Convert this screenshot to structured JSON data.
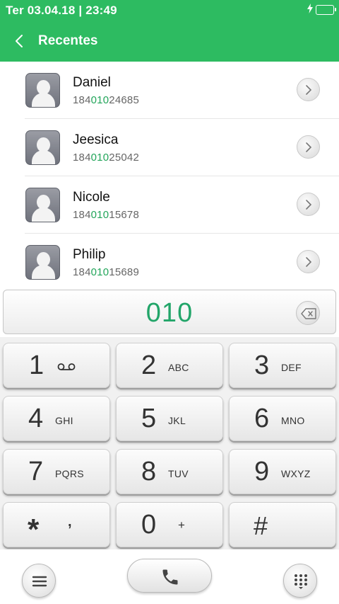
{
  "status_bar": {
    "datetime": "Ter 03.04.18 | 23:49",
    "icons": [
      "charging-icon",
      "battery-icon"
    ]
  },
  "header": {
    "back_icon": "chevron-left-icon",
    "title": "Recentes"
  },
  "contacts": [
    {
      "name": "Daniel",
      "number_prefix": "184",
      "number_match": "010",
      "number_suffix": "24685"
    },
    {
      "name": "Jeesica",
      "number_prefix": "184",
      "number_match": "010",
      "number_suffix": "25042"
    },
    {
      "name": "Nicole",
      "number_prefix": "184",
      "number_match": "010",
      "number_suffix": "15678"
    },
    {
      "name": "Philip",
      "number_prefix": "184",
      "number_match": "010",
      "number_suffix": "15689"
    }
  ],
  "dialer": {
    "input": "010",
    "backspace_icon": "backspace-icon"
  },
  "keypad": [
    {
      "digit": "1",
      "letters": ""
    },
    {
      "digit": "2",
      "letters": "ABC"
    },
    {
      "digit": "3",
      "letters": "DEF"
    },
    {
      "digit": "4",
      "letters": "GHI"
    },
    {
      "digit": "5",
      "letters": "JKL"
    },
    {
      "digit": "6",
      "letters": "MNO"
    },
    {
      "digit": "7",
      "letters": "PQRS"
    },
    {
      "digit": "8",
      "letters": "TUV"
    },
    {
      "digit": "9",
      "letters": "WXYZ"
    },
    {
      "digit": "*",
      "letters": ","
    },
    {
      "digit": "0",
      "letters": "+"
    },
    {
      "digit": "#",
      "letters": ""
    }
  ],
  "bottom_bar": {
    "left_icon": "menu-icon",
    "center_icon": "phone-icon",
    "right_icon": "dialpad-icon"
  },
  "colors": {
    "accent_green": "#2dbb61",
    "match_green": "#22a55a",
    "dial_green": "#22a569"
  }
}
